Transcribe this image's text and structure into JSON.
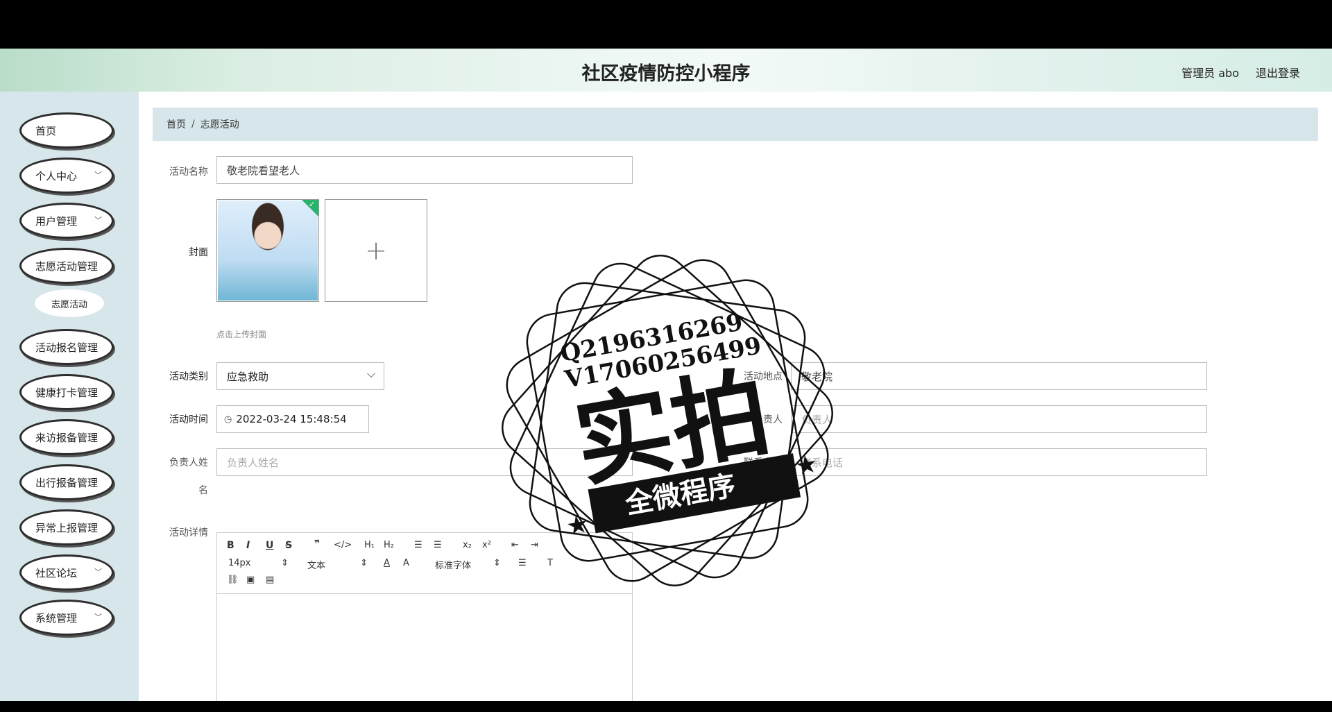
{
  "header": {
    "title": "社区疫情防控小程序",
    "user": "管理员 abo",
    "logout": "退出登录"
  },
  "sidebar": {
    "items": [
      {
        "label": "首页",
        "chevron": false
      },
      {
        "label": "个人中心",
        "chevron": true
      },
      {
        "label": "用户管理",
        "chevron": true
      },
      {
        "label": "志愿活动管理",
        "chevron": false
      },
      {
        "label": "活动报名管理",
        "chevron": false
      },
      {
        "label": "健康打卡管理",
        "chevron": false
      },
      {
        "label": "来访报备管理",
        "chevron": false
      },
      {
        "label": "出行报备管理",
        "chevron": false
      },
      {
        "label": "异常上报管理",
        "chevron": false
      },
      {
        "label": "社区论坛",
        "chevron": true
      },
      {
        "label": "系统管理",
        "chevron": true
      }
    ],
    "submenu": "志愿活动"
  },
  "breadcrumb": {
    "home": "首页",
    "sep": "/",
    "current": "志愿活动"
  },
  "form": {
    "name_label": "活动名称",
    "name_value": "敬老院看望老人",
    "cover_label": "封面",
    "cover_hint": "点击上传封面",
    "category_label": "活动类别",
    "category_value": "应急救助",
    "location_label": "活动地点",
    "location_value": "敬老院",
    "time_label": "活动时间",
    "time_value": "2022-03-24 15:48:54",
    "owner_label": "负责人",
    "owner_placeholder": "负责人",
    "owner_name_label_1": "负责人姓",
    "owner_name_label_2": "名",
    "owner_name_placeholder": "负责人姓名",
    "phone_label": "联系电话",
    "phone_placeholder": "联系电话",
    "detail_label": "活动详情"
  },
  "editor": {
    "font_size": "14px",
    "text_type": "文本",
    "font_family": "标准字体"
  },
  "stamp": {
    "line1": "Q2196316269",
    "line2": "V17060256499",
    "big": "实拍",
    "banner": "全微程序"
  }
}
